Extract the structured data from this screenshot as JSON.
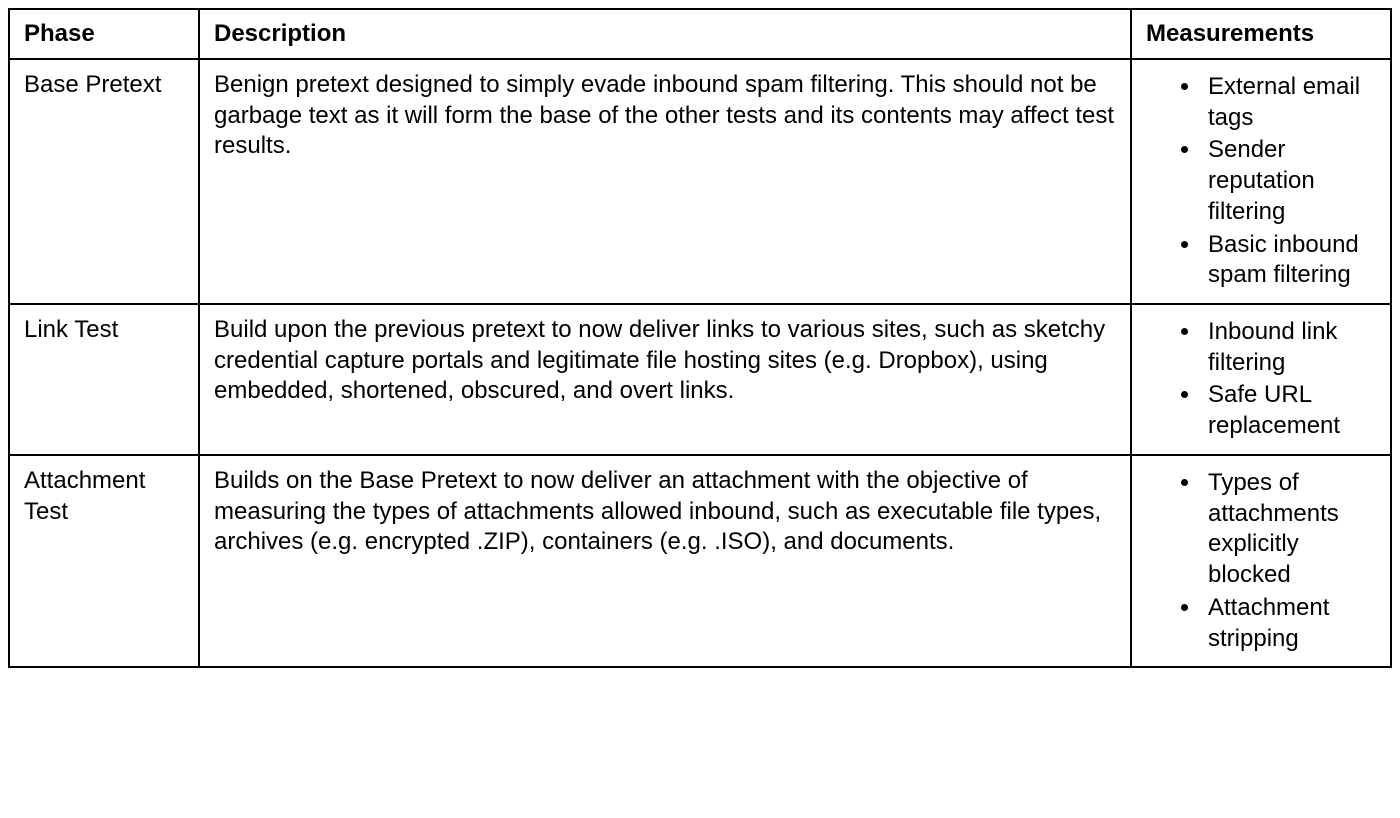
{
  "table": {
    "headers": {
      "phase": "Phase",
      "description": "Description",
      "measurements": "Measurements"
    },
    "rows": [
      {
        "phase": "Base Pretext",
        "description": "Benign pretext designed to simply evade inbound spam filtering. This should not be garbage text as it will form the base of the other tests and its contents may affect test results.",
        "measurements": [
          "External email tags",
          "Sender reputation filtering",
          "Basic inbound spam filtering"
        ]
      },
      {
        "phase": "Link Test",
        "description": "Build upon the previous pretext to now deliver links to various sites, such as sketchy credential capture portals and legitimate file hosting sites (e.g. Dropbox), using embedded, shortened, obscured, and overt links.",
        "measurements": [
          "Inbound link filtering",
          "Safe URL replacement"
        ]
      },
      {
        "phase": "Attachment Test",
        "description": "Builds on the Base Pretext to now deliver an attachment with the objective of measuring the types of attachments allowed inbound, such as executable file types, archives (e.g. encrypted .ZIP), containers (e.g. .ISO), and documents.",
        "measurements": [
          "Types of attachments explicitly blocked",
          "Attachment stripping"
        ]
      }
    ]
  }
}
